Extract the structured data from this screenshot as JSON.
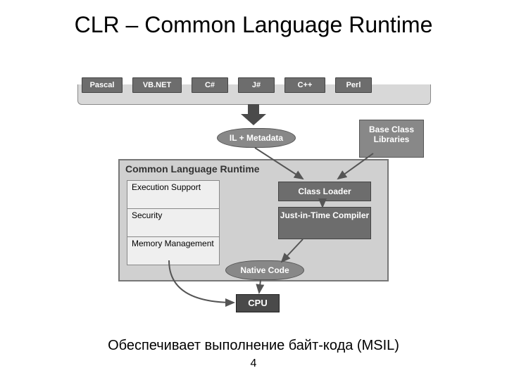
{
  "title": "CLR – Common Language Runtime",
  "caption": "Обеспечивает выполнение байт-кода (MSIL)",
  "page_number": "4",
  "languages": [
    "Pascal",
    "VB.NET",
    "C#",
    "J#",
    "C++",
    "Perl"
  ],
  "il_pill": "IL + Metadata",
  "native_pill": "Native Code",
  "bcl": "Base Class Libraries",
  "clr": {
    "label": "Common Language Runtime",
    "services": [
      "Execution Support",
      "Security",
      "Memory Management"
    ],
    "loader": "Class Loader",
    "jit": "Just-in-Time Compiler"
  },
  "cpu": "CPU"
}
